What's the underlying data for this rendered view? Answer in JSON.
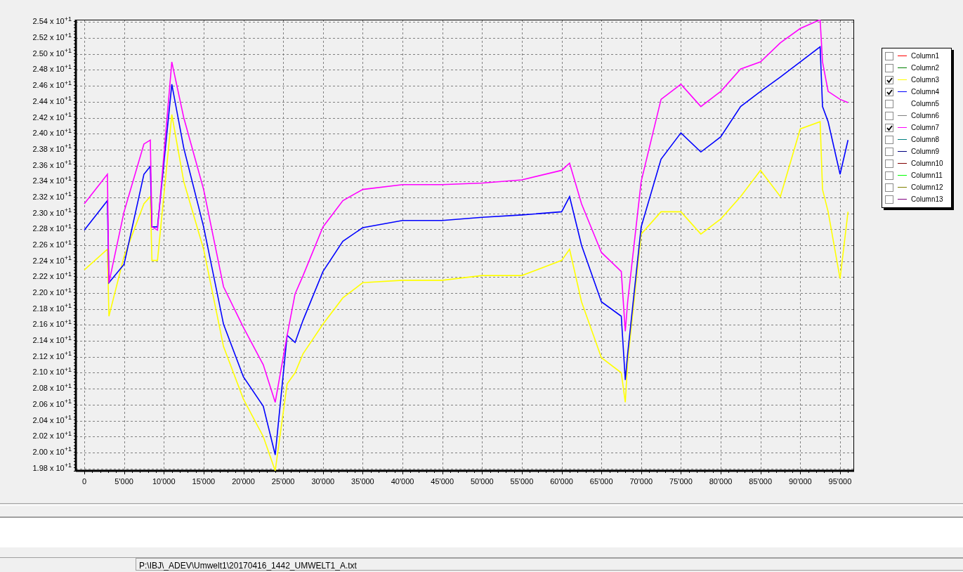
{
  "chart": {
    "chart_data": {
      "type": "line",
      "grid": true,
      "x": [
        0,
        2900,
        3100,
        5000,
        7500,
        8300,
        8500,
        9200,
        11000,
        12500,
        15000,
        17500,
        20000,
        22500,
        24000,
        25500,
        26500,
        27500,
        30000,
        32500,
        35000,
        40000,
        45000,
        50000,
        55000,
        60000,
        61000,
        62500,
        65000,
        67500,
        68000,
        68300,
        70000,
        72500,
        75000,
        77500,
        80000,
        82500,
        85000,
        87500,
        90000,
        92500,
        92800,
        93500,
        95000,
        96000
      ],
      "series": [
        {
          "color": "#ffff00",
          "values": [
            22.29,
            22.55,
            21.71,
            22.46,
            23.12,
            23.21,
            22.41,
            22.41,
            24.24,
            23.4,
            22.55,
            21.33,
            20.67,
            20.2,
            19.77,
            20.86,
            21.0,
            21.24,
            21.61,
            21.94,
            22.13,
            22.16,
            22.16,
            22.22,
            22.22,
            22.41,
            22.55,
            21.89,
            21.19,
            21.0,
            20.63,
            21.14,
            22.74,
            23.02,
            23.02,
            22.74,
            22.93,
            23.21,
            23.54,
            23.21,
            24.06,
            24.15,
            23.3,
            23.02,
            22.18,
            23.02
          ]
        },
        {
          "color": "#0000ff",
          "values": [
            22.79,
            23.16,
            22.13,
            22.36,
            23.49,
            23.59,
            22.83,
            22.83,
            24.62,
            23.82,
            22.83,
            21.61,
            20.95,
            20.58,
            19.97,
            21.47,
            21.38,
            21.66,
            22.27,
            22.65,
            22.82,
            22.91,
            22.91,
            22.95,
            22.98,
            23.02,
            23.21,
            22.6,
            21.89,
            21.71,
            20.91,
            21.24,
            22.83,
            23.68,
            24.01,
            23.77,
            23.96,
            24.34,
            24.53,
            24.71,
            24.9,
            25.09,
            24.34,
            24.15,
            23.49,
            23.92
          ]
        },
        {
          "color": "#ff00ff",
          "values": [
            23.12,
            23.49,
            22.13,
            23.02,
            23.87,
            23.92,
            22.83,
            22.79,
            24.9,
            24.2,
            23.3,
            22.08,
            21.57,
            21.1,
            20.63,
            21.47,
            21.99,
            22.22,
            22.83,
            23.16,
            23.3,
            23.36,
            23.36,
            23.38,
            23.42,
            23.54,
            23.63,
            23.12,
            22.51,
            22.27,
            21.52,
            21.89,
            23.4,
            24.43,
            24.62,
            24.34,
            24.53,
            24.81,
            24.9,
            25.14,
            25.32,
            25.43,
            24.9,
            24.53,
            24.43,
            24.39
          ]
        }
      ],
      "xlim": [
        -1060,
        96770
      ],
      "ylim": [
        19.77,
        25.43
      ],
      "xticks": [
        {
          "value": 0,
          "label": "0"
        },
        {
          "value": 5000,
          "label": "5'000"
        },
        {
          "value": 10000,
          "label": "10'000"
        },
        {
          "value": 15000,
          "label": "15'000"
        },
        {
          "value": 20000,
          "label": "20'000"
        },
        {
          "value": 25000,
          "label": "25'000"
        },
        {
          "value": 30000,
          "label": "30'000"
        },
        {
          "value": 35000,
          "label": "35'000"
        },
        {
          "value": 40000,
          "label": "40'000"
        },
        {
          "value": 45000,
          "label": "45'000"
        },
        {
          "value": 50000,
          "label": "50'000"
        },
        {
          "value": 55000,
          "label": "55'000"
        },
        {
          "value": 60000,
          "label": "60'000"
        },
        {
          "value": 65000,
          "label": "65'000"
        },
        {
          "value": 70000,
          "label": "70'000"
        },
        {
          "value": 75000,
          "label": "75'000"
        },
        {
          "value": 80000,
          "label": "80'000"
        },
        {
          "value": 85000,
          "label": "85'000"
        },
        {
          "value": 90000,
          "label": "90'000"
        },
        {
          "value": 95000,
          "label": "95'000"
        }
      ],
      "yticks": [
        {
          "value": 19.8,
          "label": "1.98 x 10$^{+1}$"
        },
        {
          "value": 20.0,
          "label": "2.00 x 10$^{+1}$"
        },
        {
          "value": 20.2,
          "label": "2.02 x 10$^{+1}$"
        },
        {
          "value": 20.4,
          "label": "2.04 x 10$^{+1}$"
        },
        {
          "value": 20.6,
          "label": "2.06 x 10$^{+1}$"
        },
        {
          "value": 20.8,
          "label": "2.08 x 10$^{+1}$"
        },
        {
          "value": 21.0,
          "label": "2.10 x 10$^{+1}$"
        },
        {
          "value": 21.2,
          "label": "2.12 x 10$^{+1}$"
        },
        {
          "value": 21.4,
          "label": "2.14 x 10$^{+1}$"
        },
        {
          "value": 21.6,
          "label": "2.16 x 10$^{+1}$"
        },
        {
          "value": 21.8,
          "label": "2.18 x 10$^{+1}$"
        },
        {
          "value": 22.0,
          "label": "2.20 x 10$^{+1}$"
        },
        {
          "value": 22.2,
          "label": "2.22 x 10$^{+1}$"
        },
        {
          "value": 22.4,
          "label": "2.24 x 10$^{+1}$"
        },
        {
          "value": 22.6,
          "label": "2.26 x 10$^{+1}$"
        },
        {
          "value": 22.8,
          "label": "2.28 x 10$^{+1}$"
        },
        {
          "value": 23.0,
          "label": "2.30 x 10$^{+1}$"
        },
        {
          "value": 23.2,
          "label": "2.32 x 10$^{+1}$"
        },
        {
          "value": 23.4,
          "label": "2.34 x 10$^{+1}$"
        },
        {
          "value": 23.6,
          "label": "2.36 x 10$^{+1}$"
        },
        {
          "value": 23.8,
          "label": "2.38 x 10$^{+1}$"
        },
        {
          "value": 24.0,
          "label": "2.40 x 10$^{+1}$"
        },
        {
          "value": 24.2,
          "label": "2.42 x 10$^{+1}$"
        },
        {
          "value": 24.4,
          "label": "2.44 x 10$^{+1}$"
        },
        {
          "value": 24.6,
          "label": "2.46 x 10$^{+1}$"
        },
        {
          "value": 24.8,
          "label": "2.48 x 10$^{+1}$"
        },
        {
          "value": 25.0,
          "label": "2.50 x 10$^{+1}$"
        },
        {
          "value": 25.2,
          "label": "2.52 x 10$^{+1}$"
        },
        {
          "value": 25.4,
          "label": "2.54 x 10$^{+1}$"
        }
      ]
    }
  },
  "legend": [
    {
      "label": "Column1",
      "checked": false,
      "color": "#ff0000"
    },
    {
      "label": "Column2",
      "checked": false,
      "color": "#008000"
    },
    {
      "label": "Column3",
      "checked": true,
      "color": "#ffff00"
    },
    {
      "label": "Column4",
      "checked": true,
      "color": "#0000ff"
    },
    {
      "label": "Column5",
      "checked": false
    },
    {
      "label": "Column6",
      "checked": false,
      "color": "#808080"
    },
    {
      "label": "Column7",
      "checked": true,
      "color": "#ff00ff"
    },
    {
      "label": "Column8",
      "checked": false,
      "color": "#008080"
    },
    {
      "label": "Column9",
      "checked": false,
      "color": "#000080"
    },
    {
      "label": "Column10",
      "checked": false,
      "color": "#800000"
    },
    {
      "label": "Column11",
      "checked": false,
      "color": "#00ff00"
    },
    {
      "label": "Column12",
      "checked": false,
      "color": "#808000"
    },
    {
      "label": "Column13",
      "checked": false,
      "color": "#800080"
    }
  ],
  "status_bar": {
    "file_path": "P:\\IBJ\\_ADEV\\Umwelt1\\20170416_1442_UMWELT1_A.txt"
  }
}
